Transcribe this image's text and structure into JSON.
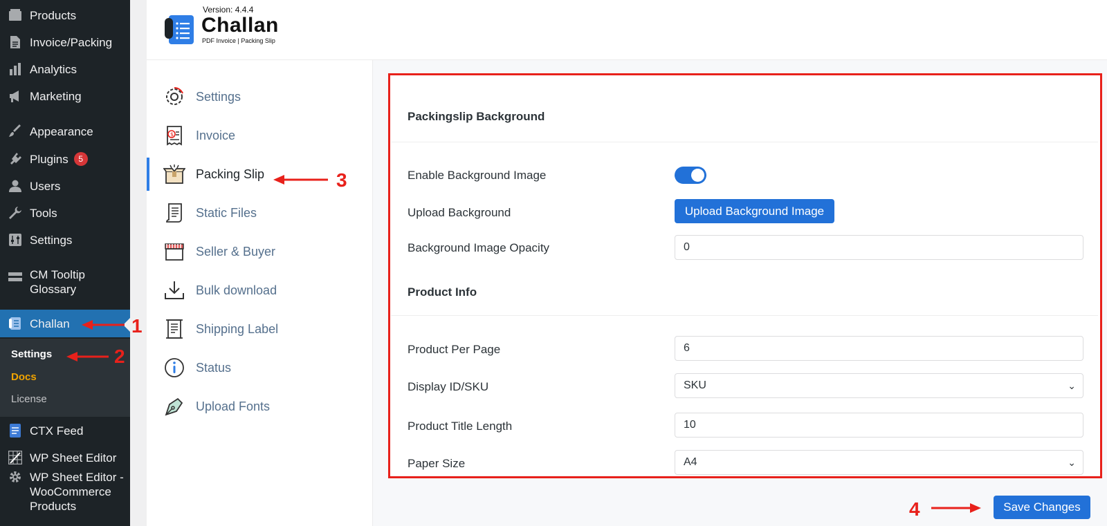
{
  "wp_menu": {
    "products": "Products",
    "invoice_packing": "Invoice/Packing",
    "analytics": "Analytics",
    "marketing": "Marketing",
    "appearance": "Appearance",
    "plugins": "Plugins",
    "plugins_badge": "5",
    "users": "Users",
    "tools": "Tools",
    "settings": "Settings",
    "cm_tooltip_line1": "CM Tooltip",
    "cm_tooltip_line2": "Glossary",
    "challan": "Challan",
    "sub_settings": "Settings",
    "sub_docs": "Docs",
    "sub_license": "License",
    "ctx_feed": "CTX Feed",
    "wp_sheet_editor": "WP Sheet Editor",
    "wp_sheet_woo_line1": "WP Sheet Editor -",
    "wp_sheet_woo_line2": "WooCommerce",
    "wp_sheet_woo_line3": "Products"
  },
  "plugin_header": {
    "version": "Version: 4.4.4",
    "logo_title": "Challan",
    "logo_subtitle": "PDF Invoice | Packing Slip"
  },
  "tabs": [
    {
      "label": "Settings"
    },
    {
      "label": "Invoice"
    },
    {
      "label": "Packing Slip"
    },
    {
      "label": "Static Files"
    },
    {
      "label": "Seller & Buyer"
    },
    {
      "label": "Bulk download"
    },
    {
      "label": "Shipping Label"
    },
    {
      "label": "Status"
    },
    {
      "label": "Upload Fonts"
    }
  ],
  "form": {
    "bg_section_title": "Packingslip Background",
    "enable_bg_label": "Enable Background Image",
    "enable_bg_value": true,
    "upload_bg_label": "Upload Background",
    "upload_bg_button": "Upload Background Image",
    "opacity_label": "Background Image Opacity",
    "opacity_value": "0",
    "product_section_title": "Product Info",
    "per_page_label": "Product Per Page",
    "per_page_value": "6",
    "display_id_label": "Display ID/SKU",
    "display_id_value": "SKU",
    "title_length_label": "Product Title Length",
    "title_length_value": "10",
    "paper_size_label": "Paper Size",
    "paper_size_value": "A4",
    "save_button": "Save Changes"
  },
  "annotations": {
    "n1": "1",
    "n2": "2",
    "n3": "3",
    "n4": "4"
  },
  "colors": {
    "accent": "#2271d8",
    "wp_active": "#2271b1",
    "annotation": "#e8211b",
    "docs": "#f0a300"
  }
}
